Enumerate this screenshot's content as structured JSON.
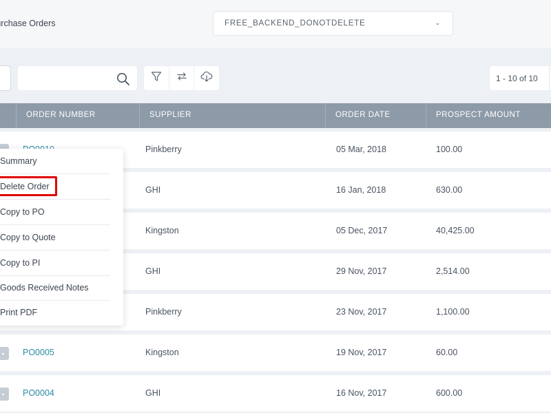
{
  "header": {
    "title": "Purchase Orders",
    "company": "FREE_BACKEND_DONOTDELETE"
  },
  "toolbar": {
    "search_value": "",
    "pager_text": "1 - 10 of 10"
  },
  "table": {
    "columns": [
      "ORDER NUMBER",
      "SUPPLIER",
      "ORDER DATE",
      "PROSPECT AMOUNT"
    ],
    "rows": [
      {
        "order": "PO0010",
        "supplier": "Pinkberry",
        "date": "05 Mar, 2018",
        "amount": "100.00"
      },
      {
        "order": "",
        "supplier": "GHI",
        "date": "16 Jan, 2018",
        "amount": "630.00"
      },
      {
        "order": "",
        "supplier": "Kingston",
        "date": "05 Dec, 2017",
        "amount": "40,425.00"
      },
      {
        "order": "",
        "supplier": "GHI",
        "date": "29 Nov, 2017",
        "amount": "2,514.00"
      },
      {
        "order": "",
        "supplier": "Pinkberry",
        "date": "23 Nov, 2017",
        "amount": "1,100.00"
      },
      {
        "order": "PO0005",
        "supplier": "Kingston",
        "date": "19 Nov, 2017",
        "amount": "60.00"
      },
      {
        "order": "PO0004",
        "supplier": "GHI",
        "date": "16 Nov, 2017",
        "amount": "600.00"
      }
    ]
  },
  "context_menu": {
    "items": [
      "Summary",
      "Delete Order",
      "Copy to PO",
      "Copy to Quote",
      "Copy to PI",
      "Goods Received Notes",
      "Print PDF"
    ],
    "highlighted": "Delete Order"
  },
  "icons": {
    "search": "search-icon",
    "filter": "filter-icon",
    "transfer": "transfer-icon",
    "download": "cloud-download-icon",
    "dropdown": "chevron-down-icon"
  },
  "colors": {
    "header_bar": "#8d9aa8",
    "link": "#2b8aa3",
    "highlight_box": "#e00000"
  }
}
